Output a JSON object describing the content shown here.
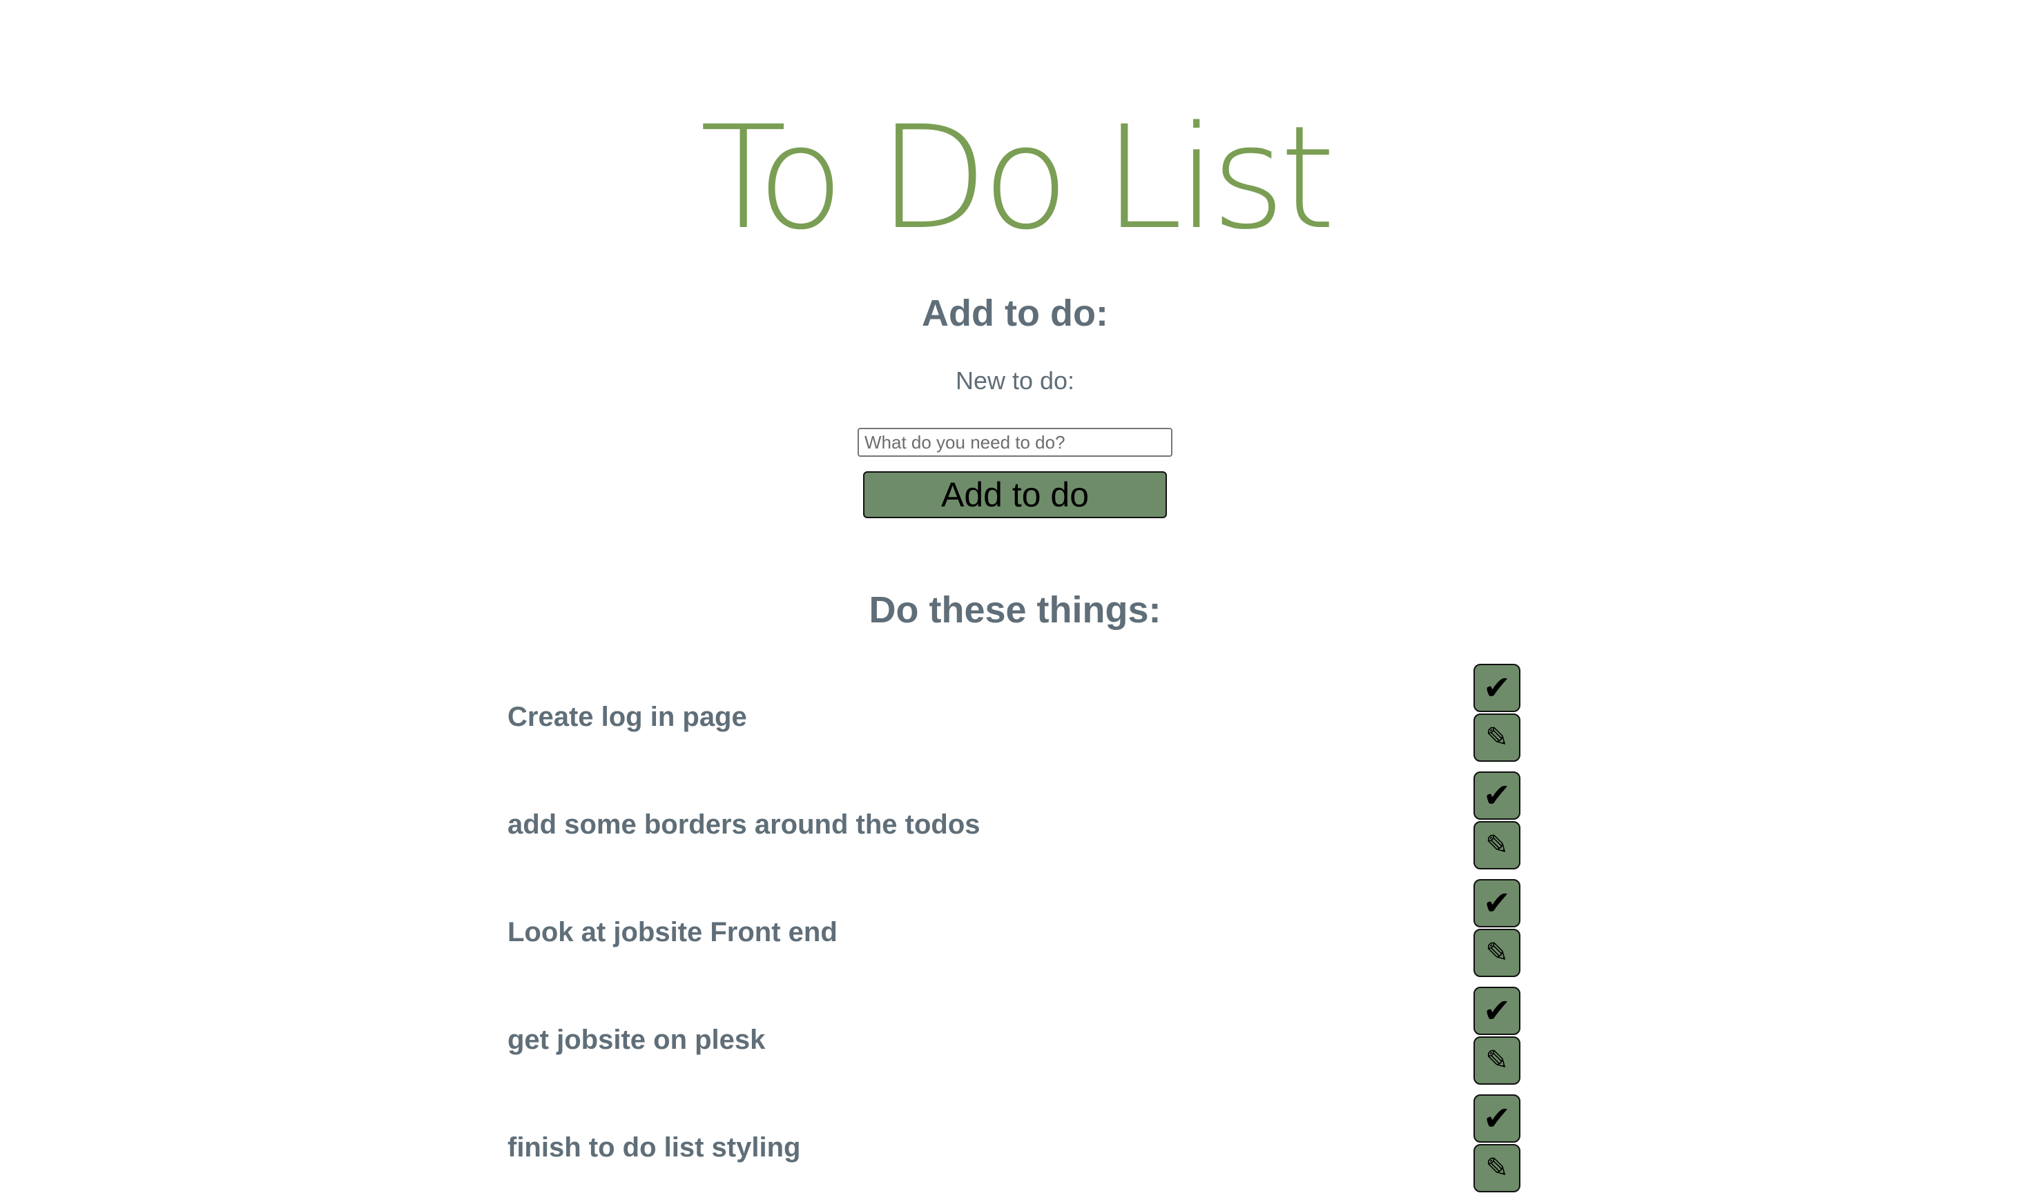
{
  "header": {
    "title": "To Do List"
  },
  "add_section": {
    "heading": "Add to do:",
    "field_label": "New to do:",
    "input_value": "",
    "input_placeholder": "What do you need to do?",
    "button_label": "Add to do"
  },
  "list_section": {
    "heading": "Do these things:",
    "items": [
      {
        "text": "Create log in page"
      },
      {
        "text": "add some borders around the todos"
      },
      {
        "text": "Look at jobsite Front end"
      },
      {
        "text": "get jobsite on plesk"
      },
      {
        "text": "finish to do list styling"
      }
    ]
  },
  "icons": {
    "done": "check-icon",
    "edit": "pencil-icon",
    "done_glyph": "✔",
    "edit_glyph": "✎"
  },
  "colors": {
    "title": "#7a9e54",
    "heading_text": "#5f6e78",
    "button_fill": "#6e8c69"
  }
}
